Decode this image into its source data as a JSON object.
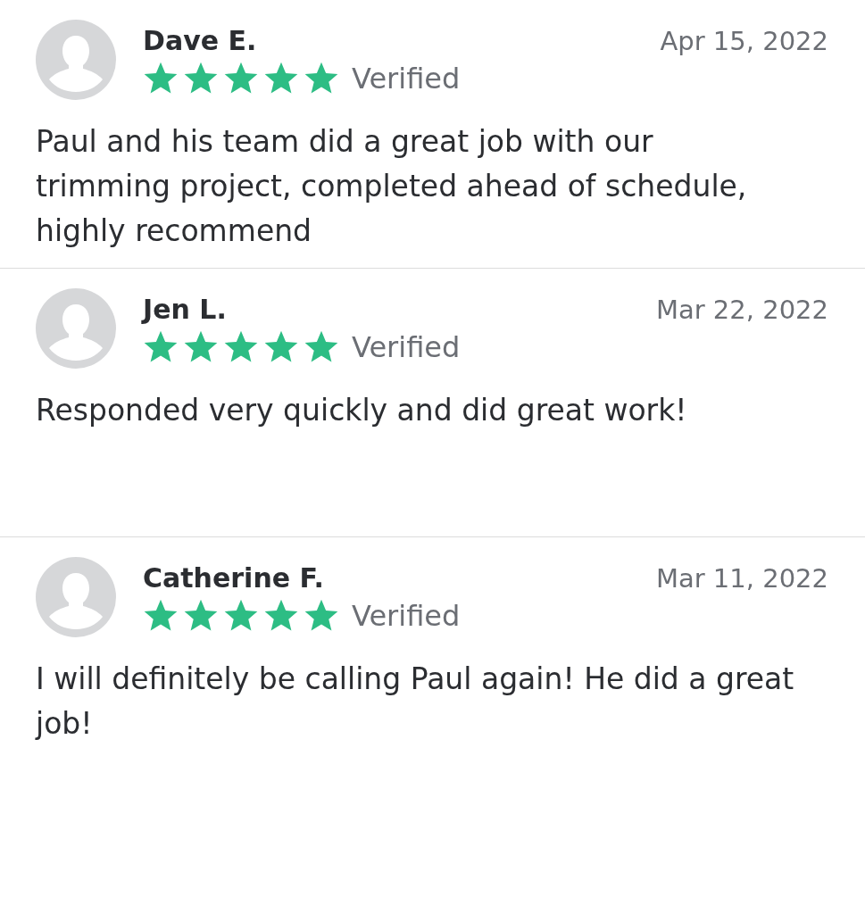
{
  "reviews": [
    {
      "name": "Dave E.",
      "date": "Apr 15, 2022",
      "stars": 5,
      "verified": true,
      "verified_label": "Verified",
      "text": "Paul and his team did a great job with our trimming project, completed ahead of schedule, highly recommend"
    },
    {
      "name": "Jen L.",
      "date": "Mar 22, 2022",
      "stars": 5,
      "verified": true,
      "verified_label": "Verified",
      "text": "Responded very quickly and did great work!"
    },
    {
      "name": "Catherine F.",
      "date": "Mar 11, 2022",
      "stars": 5,
      "verified": true,
      "verified_label": "Verified",
      "text": "I will definitely be calling Paul again! He did a great job!"
    }
  ]
}
